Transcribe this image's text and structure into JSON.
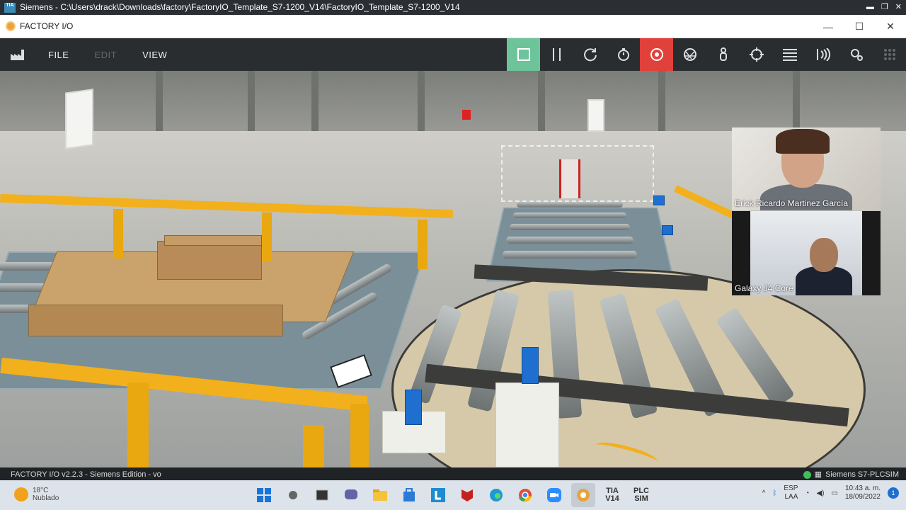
{
  "outer_window": {
    "icon_text": "TIA",
    "title": "Siemens  -  C:\\Users\\drack\\Downloads\\factory\\FactoryIO_Template_S7-1200_V14\\FactoryIO_Template_S7-1200_V14"
  },
  "app_window": {
    "title": "FACTORY I/O",
    "minimize": "—",
    "maximize": "☐",
    "close": "✕"
  },
  "menu": {
    "file": "FILE",
    "edit": "EDIT",
    "view": "VIEW"
  },
  "toolbar": {
    "play_icon": "stop-square-icon",
    "pause_icon": "pause-icon",
    "reset_icon": "reset-icon",
    "timer_icon": "stopwatch-icon",
    "record_icon": "camera-icon",
    "fly_icon": "aperture-icon",
    "walk_icon": "person-icon",
    "crosshair_icon": "crosshair-icon",
    "list_icon": "list-icon",
    "sensor_icon": "sensor-icon",
    "settings_icon": "settings-icon",
    "grid_icon": "grid-icon",
    "colors": {
      "play_bg": "#6ec49a",
      "record_bg": "#e0413a"
    }
  },
  "video_call": {
    "participant1": "Erick Ricardo Martinez García",
    "participant2": "Galaxy J4 Core"
  },
  "statusbar": {
    "left": "FACTORY I/O v2.2.3 - Siemens Edition - vo",
    "right": "Siemens S7-PLCSIM"
  },
  "taskbar": {
    "weather_temp": "18°C",
    "weather_desc": "Nublado",
    "tia_label": "TIA\nV14",
    "plcsim_label": "PLC\nSIM",
    "lang": "ESP",
    "lang2": "LAA",
    "time": "10:43 a. m.",
    "date": "18/09/2022",
    "notifications": "1"
  }
}
